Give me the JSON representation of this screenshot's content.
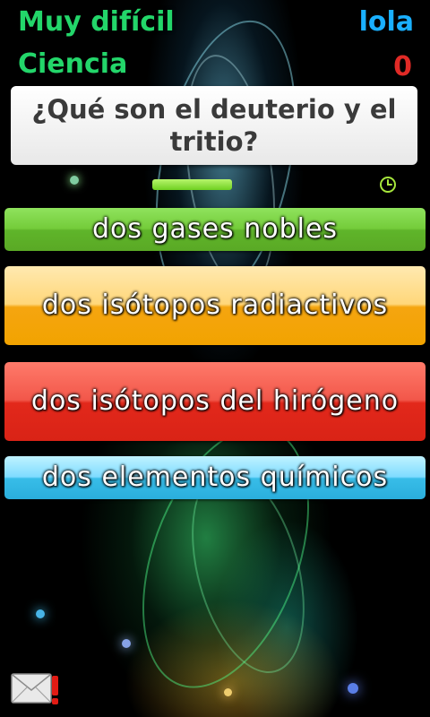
{
  "hud": {
    "difficulty": "Muy difícil",
    "category": "Ciencia",
    "player": "lola",
    "score": "0"
  },
  "question": {
    "text": "¿Qué son el deuterio y el tritio?"
  },
  "timer": {
    "remaining_fraction": 0.19,
    "icon": "clock-icon"
  },
  "answers": [
    {
      "label": "dos gases nobles",
      "color": "#6cc233"
    },
    {
      "label": "dos isótopos radiactivos",
      "color": "#f5a510"
    },
    {
      "label": "dos isótopos del hirógeno",
      "color": "#e2281b"
    },
    {
      "label": "dos elementos químicos",
      "color": "#38bde8"
    }
  ],
  "footer": {
    "report_icon": "mail-alert-icon"
  }
}
